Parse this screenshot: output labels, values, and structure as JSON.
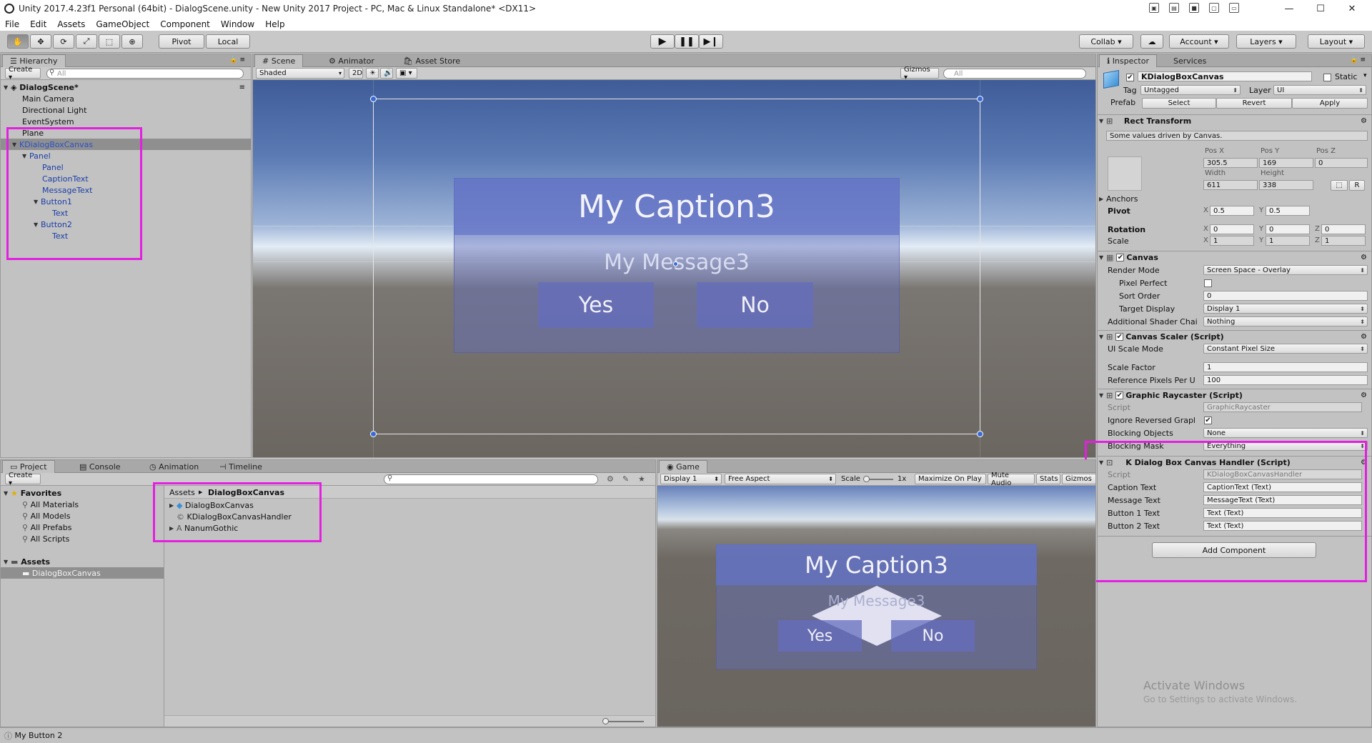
{
  "window": {
    "title": "Unity 2017.4.23f1 Personal (64bit) - DialogScene.unity - New Unity 2017 Project - PC, Mac & Linux Standalone* <DX11>"
  },
  "menu": [
    "File",
    "Edit",
    "Assets",
    "GameObject",
    "Component",
    "Window",
    "Help"
  ],
  "toolbar": {
    "pivot": "Pivot",
    "local": "Local",
    "collab": "Collab ▾",
    "account": "Account",
    "layers": "Layers",
    "layout": "Layout"
  },
  "hierarchy": {
    "tab": "Hierarchy",
    "create": "Create ▾",
    "search_placeholder": "All",
    "scene": "DialogScene*",
    "items": [
      {
        "label": "Main Camera"
      },
      {
        "label": "Directional Light"
      },
      {
        "label": "EventSystem"
      },
      {
        "label": "Plane"
      },
      {
        "label": "KDialogBoxCanvas"
      },
      {
        "label": "Panel"
      },
      {
        "label": "Panel"
      },
      {
        "label": "CaptionText"
      },
      {
        "label": "MessageText"
      },
      {
        "label": "Button1"
      },
      {
        "label": "Text"
      },
      {
        "label": "Button2"
      },
      {
        "label": "Text"
      }
    ]
  },
  "scene": {
    "tabs": [
      "Scene",
      "Animator",
      "Asset Store"
    ],
    "shading": "Shaded",
    "mode2d": "2D",
    "gizmos": "Gizmos ▾",
    "search_placeholder": "All",
    "caption": "My Caption3",
    "message": "My Message3",
    "yes": "Yes",
    "no": "No"
  },
  "project": {
    "tabs": [
      "Project",
      "Console",
      "Animation",
      "Timeline"
    ],
    "create": "Create ▾",
    "favorites_label": "Favorites",
    "favorites": [
      "All Materials",
      "All Models",
      "All Prefabs",
      "All Scripts"
    ],
    "assets_label": "Assets",
    "assets_folder": "DialogBoxCanvas",
    "breadcrumb_root": "Assets",
    "breadcrumb_sep": "▶",
    "breadcrumb_leaf": "DialogBoxCanvas",
    "files": [
      "DialogBoxCanvas",
      "KDialogBoxCanvasHandler",
      "NanumGothic"
    ]
  },
  "game": {
    "tab": "Game",
    "display": "Display 1",
    "aspect": "Free Aspect",
    "scale_label": "Scale",
    "scale_value": "1x",
    "maximize": "Maximize On Play",
    "mute": "Mute Audio",
    "stats": "Stats",
    "gizmos": "Gizmos",
    "caption": "My Caption3",
    "message": "My Message3",
    "yes": "Yes",
    "no": "No"
  },
  "inspector": {
    "tabs": [
      "Inspector",
      "Services"
    ],
    "object_name": "KDialogBoxCanvas",
    "static": "Static",
    "tag_label": "Tag",
    "tag": "Untagged",
    "layer_label": "Layer",
    "layer": "UI",
    "prefab_label": "Prefab",
    "select": "Select",
    "revert": "Revert",
    "apply": "Apply",
    "rect": {
      "title": "Rect Transform",
      "note": "Some values driven by Canvas.",
      "posx_l": "Pos X",
      "posy_l": "Pos Y",
      "posz_l": "Pos Z",
      "posx": "305.5",
      "posy": "169",
      "posz": "0",
      "width_l": "Width",
      "height_l": "Height",
      "width": "611",
      "height": "338",
      "r": "R",
      "anchors": "Anchors",
      "pivot": "Pivot",
      "pivot_x": "0.5",
      "pivot_y": "0.5",
      "rotation": "Rotation",
      "rot_x": "0",
      "rot_y": "0",
      "rot_z": "0",
      "scale": "Scale",
      "sc_x": "1",
      "sc_y": "1",
      "sc_z": "1",
      "x": "X",
      "y": "Y",
      "z": "Z"
    },
    "canvas": {
      "title": "Canvas",
      "render_mode_l": "Render Mode",
      "render_mode": "Screen Space - Overlay",
      "pixel_perfect_l": "Pixel Perfect",
      "sort_order_l": "Sort Order",
      "sort_order": "0",
      "target_display_l": "Target Display",
      "target_display": "Display 1",
      "shader_l": "Additional Shader Chai",
      "shader": "Nothing"
    },
    "scaler": {
      "title": "Canvas Scaler (Script)",
      "mode_l": "UI Scale Mode",
      "mode": "Constant Pixel Size",
      "factor_l": "Scale Factor",
      "factor": "1",
      "ref_l": "Reference Pixels Per U",
      "ref": "100"
    },
    "raycaster": {
      "title": "Graphic Raycaster (Script)",
      "script_l": "Script",
      "script": "GraphicRaycaster",
      "ignore_l": "Ignore Reversed Grapl",
      "blocking_l": "Blocking Objects",
      "blocking": "None",
      "mask_l": "Blocking Mask",
      "mask": "Everything"
    },
    "handler": {
      "title": "K Dialog Box Canvas Handler (Script)",
      "script_l": "Script",
      "script": "KDialogBoxCanvasHandler",
      "caption_l": "Caption Text",
      "caption": "CaptionText (Text)",
      "message_l": "Message Text",
      "message": "MessageText (Text)",
      "b1_l": "Button 1 Text",
      "b1": "Text (Text)",
      "b2_l": "Button 2 Text",
      "b2": "Text (Text)"
    },
    "add_component": "Add Component",
    "watermark1": "Activate Windows",
    "watermark2": "Go to Settings to activate Windows."
  },
  "status": {
    "text": "My Button 2"
  }
}
